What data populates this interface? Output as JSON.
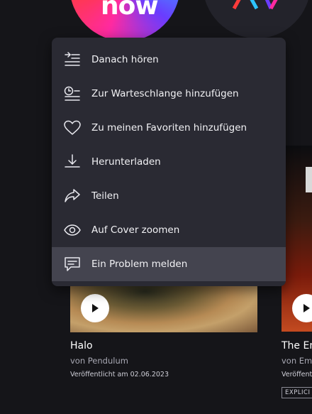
{
  "background_top": {
    "left_badge_text": "now",
    "accent_colors": [
      "#ff2aa0",
      "#ffb000",
      "#2ec4ff",
      "#6a3cff"
    ]
  },
  "menu": {
    "items": [
      {
        "label": "Danach hören",
        "icon": "play-next-icon"
      },
      {
        "label": "Zur Warteschlange hinzufügen",
        "icon": "add-to-queue-icon"
      },
      {
        "label": "Zu meinen Favoriten hinzufügen",
        "icon": "heart-icon"
      },
      {
        "label": "Herunterladen",
        "icon": "download-icon"
      },
      {
        "label": "Teilen",
        "icon": "share-icon"
      },
      {
        "label": "Auf Cover zoomen",
        "icon": "eye-icon"
      },
      {
        "label": "Ein Problem melden",
        "icon": "report-problem-icon",
        "highlighted": true
      }
    ]
  },
  "cards": [
    {
      "title": "Halo",
      "artist": "von Pendulum",
      "release": "Veröffentlicht am 02.06.2023"
    },
    {
      "title": "The Em",
      "artist": "von Emi",
      "release": "Veröffentl",
      "badge": "EXPLICI"
    }
  ],
  "colors": {
    "background": "#151519",
    "menu_background": "#2a2a33",
    "menu_highlight": "#44444f",
    "text_primary": "#ffffff",
    "text_secondary": "#a8a8b3"
  }
}
